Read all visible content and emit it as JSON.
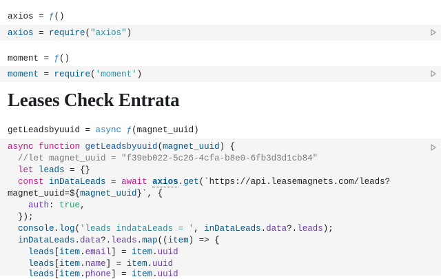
{
  "cells": [
    {
      "output": {
        "name": "axios",
        "eq": " = ",
        "fn": "ƒ",
        "parens": "()"
      },
      "code": {
        "var": "axios",
        "eq": " = ",
        "call": "require",
        "open": "(",
        "arg": "\"axios\"",
        "close": ")"
      }
    },
    {
      "output": {
        "name": "moment",
        "eq": " = ",
        "fn": "ƒ",
        "parens": "()"
      },
      "code": {
        "var": "moment",
        "eq": " = ",
        "call": "require",
        "open": "(",
        "arg": "'moment'",
        "close": ")"
      }
    }
  ],
  "heading": "Leases Check Entrata",
  "func_output": {
    "name": "getLeadsbyuuid",
    "eq": " = ",
    "async": "async ",
    "fn": "ƒ",
    "params": "(magnet_uuid)"
  },
  "func_code": {
    "l1_kw1": "async ",
    "l1_kw2": "function ",
    "l1_name": "getLeadsbyuuid",
    "l1_open": "(",
    "l1_param": "magnet_uuid",
    "l1_close": ") {",
    "l2_comment": "//let magnet_uuid = \"f39eb022-5c26-4cfa-b8e0-6fb3d3d1cb84\"",
    "l3_kw": "let ",
    "l3_var": "leads",
    "l3_rest": " = {}",
    "l4_kw": "const ",
    "l4_var": "inDataLeads",
    "l4_eq": " = ",
    "l4_await": "await ",
    "l4_axios": "axios",
    "l4_dot": ".",
    "l4_get": "get",
    "l4_str": "(`https://api.leasemagnets.com/leads?",
    "l5_str1": "magnet_uuid=${",
    "l5_var": "magnet_uuid",
    "l5_str2": "}`, {",
    "l6_prop": "auth",
    "l6_colon": ": ",
    "l6_bool": "true",
    "l6_comma": ",",
    "l7": "});",
    "l8_obj": "console",
    "l8_dot": ".",
    "l8_fn": "log",
    "l8_open": "(",
    "l8_str": "'leads indataLeads = '",
    "l8_comma": ", ",
    "l8_var": "inDataLeads",
    "l8_dot2": ".",
    "l8_prop": "data",
    "l8_opt": "?.",
    "l8_prop2": "leads",
    "l8_close": ");",
    "l9_var": "inDataLeads",
    "l9_dot": ".",
    "l9_prop": "data",
    "l9_opt": "?.",
    "l9_prop2": "leads",
    "l9_dot2": ".",
    "l9_fn": "map",
    "l9_open": "((",
    "l9_param": "item",
    "l9_close": ") => {",
    "l10_var": "leads",
    "l10_b": "[",
    "l10_item": "item",
    "l10_dot": ".",
    "l10_prop": "email",
    "l10_eq": "] = ",
    "l10_item2": "item",
    "l10_dot2": ".",
    "l10_prop2": "uuid",
    "l11_var": "leads",
    "l11_b": "[",
    "l11_item": "item",
    "l11_dot": ".",
    "l11_prop": "name",
    "l11_eq": "] = ",
    "l11_item2": "item",
    "l11_dot2": ".",
    "l11_prop2": "uuid",
    "l12_var": "leads",
    "l12_b": "[",
    "l12_item": "item",
    "l12_dot": ".",
    "l12_prop": "phone",
    "l12_eq": "] = ",
    "l12_item2": "item",
    "l12_dot2": ".",
    "l12_prop2": "uuid"
  }
}
